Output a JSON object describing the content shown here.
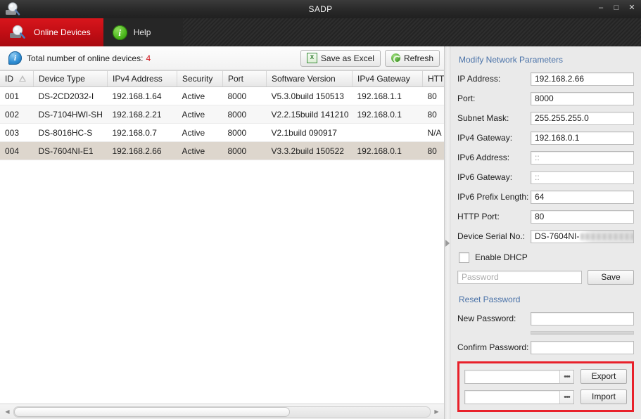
{
  "window": {
    "title": "SADP",
    "logo_icon": "magnifier-device-icon",
    "minimize_label": "–",
    "maximize_label": "□",
    "close_label": "✕"
  },
  "tabs": [
    {
      "id": "online-devices",
      "label": "Online Devices",
      "icon": "magnifier-device-icon",
      "active": true
    },
    {
      "id": "help",
      "label": "Help",
      "icon": "info-circle-icon",
      "active": false
    }
  ],
  "statusbar": {
    "info_icon": "info-bubble-icon",
    "text": "Total number of online devices:",
    "count": "4",
    "count_color": "#d0161c",
    "save_excel_label": "Save as Excel",
    "save_excel_icon": "excel-icon",
    "refresh_label": "Refresh",
    "refresh_icon": "refresh-icon"
  },
  "table": {
    "columns": [
      "ID",
      "Device Type",
      "IPv4 Address",
      "Security",
      "Port",
      "Software Version",
      "IPv4 Gateway",
      "HTTP Port"
    ],
    "sort_column": "ID",
    "sort_direction": "ascending",
    "rows": [
      {
        "id": "001",
        "device_type": "DS-2CD2032-I",
        "ipv4": "192.168.1.64",
        "security": "Active",
        "port": "8000",
        "software": "V5.3.0build 150513",
        "gateway": "192.168.1.1",
        "http_port": "80",
        "selected": false
      },
      {
        "id": "002",
        "device_type": "DS-7104HWI-SH",
        "ipv4": "192.168.2.21",
        "security": "Active",
        "port": "8000",
        "software": "V2.2.15build 141210",
        "gateway": "192.168.0.1",
        "http_port": "80",
        "selected": false
      },
      {
        "id": "003",
        "device_type": "DS-8016HC-S",
        "ipv4": "192.168.0.7",
        "security": "Active",
        "port": "8000",
        "software": "V2.1build 090917",
        "gateway": "",
        "http_port": "N/A",
        "selected": false
      },
      {
        "id": "004",
        "device_type": "DS-7604NI-E1",
        "ipv4": "192.168.2.66",
        "security": "Active",
        "port": "8000",
        "software": "V3.3.2build 150522",
        "gateway": "192.168.0.1",
        "http_port": "80",
        "selected": true
      }
    ]
  },
  "scrollbar": {
    "left_arrow": "◀",
    "right_arrow": "▶"
  },
  "splitter": {
    "collapse_icon": "chevron-right-icon"
  },
  "panel": {
    "modify_title": "Modify Network Parameters",
    "fields": [
      {
        "key": "ip_address",
        "label": "IP Address:",
        "value": "192.168.2.66",
        "muted": false
      },
      {
        "key": "port",
        "label": "Port:",
        "value": "8000",
        "muted": false
      },
      {
        "key": "subnet_mask",
        "label": "Subnet Mask:",
        "value": "255.255.255.0",
        "muted": false
      },
      {
        "key": "ipv4_gateway",
        "label": "IPv4 Gateway:",
        "value": "192.168.0.1",
        "muted": false
      },
      {
        "key": "ipv6_address",
        "label": "IPv6 Address:",
        "value": "::",
        "muted": true
      },
      {
        "key": "ipv6_gateway",
        "label": "IPv6 Gateway:",
        "value": "::",
        "muted": true
      },
      {
        "key": "ipv6_prefix",
        "label": "IPv6 Prefix Length:",
        "value": "64",
        "muted": false
      },
      {
        "key": "http_port",
        "label": "HTTP Port:",
        "value": "80",
        "muted": false
      }
    ],
    "serial": {
      "label": "Device Serial No.:",
      "value": "DS-7604NI-",
      "redacted": true
    },
    "dhcp": {
      "label": "Enable DHCP",
      "checked": false
    },
    "password": {
      "placeholder": "Password",
      "value": "",
      "save_label": "Save"
    },
    "reset_title": "Reset Password",
    "new_password": {
      "label": "New Password:",
      "value": ""
    },
    "confirm_password": {
      "label": "Confirm Password:",
      "value": ""
    },
    "export_import": {
      "highlight_color": "#e8202a",
      "export_path": "",
      "import_path": "",
      "browse_label": "•••",
      "export_label": "Export",
      "import_label": "Import"
    }
  }
}
